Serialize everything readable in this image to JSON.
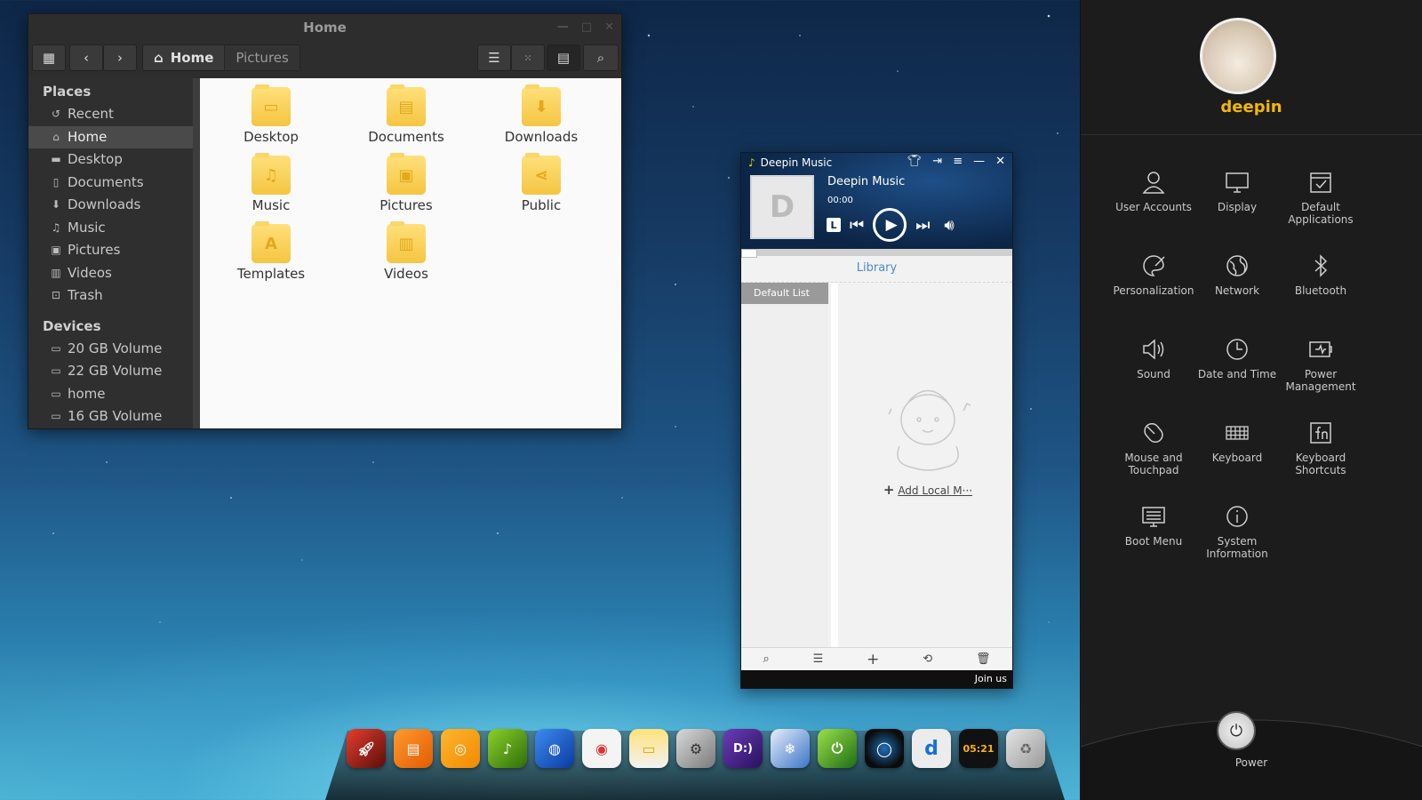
{
  "file_manager": {
    "title": "Home",
    "breadcrumb": [
      "Home",
      "Pictures"
    ],
    "sidebar": {
      "places_header": "Places",
      "places": [
        {
          "label": "Recent",
          "icon": "recent-icon"
        },
        {
          "label": "Home",
          "icon": "home-icon"
        },
        {
          "label": "Desktop",
          "icon": "desktop-icon"
        },
        {
          "label": "Documents",
          "icon": "documents-icon"
        },
        {
          "label": "Downloads",
          "icon": "downloads-icon"
        },
        {
          "label": "Music",
          "icon": "music-icon"
        },
        {
          "label": "Pictures",
          "icon": "pictures-icon"
        },
        {
          "label": "Videos",
          "icon": "videos-icon"
        },
        {
          "label": "Trash",
          "icon": "trash-icon"
        }
      ],
      "devices_header": "Devices",
      "devices": [
        "20 GB Volume",
        "22 GB Volume",
        "home",
        "16 GB Volume"
      ]
    },
    "folders": [
      "Desktop",
      "Documents",
      "Downloads",
      "Music",
      "Pictures",
      "Public",
      "Templates",
      "Videos"
    ]
  },
  "music_player": {
    "app_title": "Deepin Music",
    "song_title": "Deepin Music",
    "time": "00:00",
    "mode_label": "L",
    "library_tab": "Library",
    "playlist": "Default List",
    "add_link_plus": "+",
    "add_link": "Add Local M···",
    "join": "Join us"
  },
  "dock": {
    "items": [
      "launcher",
      "appstore",
      "deepin-movie",
      "deepin-music",
      "browser",
      "chrome",
      "file-manager",
      "system-settings",
      "deepin-terminal",
      "network",
      "power",
      "screen-recorder",
      "deepin-logo",
      "clock",
      "trash"
    ],
    "clock_label": "05:21"
  },
  "control_center": {
    "username": "deepin",
    "items": [
      {
        "label": "User Accounts",
        "icon": "user-icon"
      },
      {
        "label": "Display",
        "icon": "display-icon"
      },
      {
        "label": "Default Applications",
        "icon": "default-apps-icon"
      },
      {
        "label": "Personalization",
        "icon": "palette-icon"
      },
      {
        "label": "Network",
        "icon": "globe-icon"
      },
      {
        "label": "Bluetooth",
        "icon": "bluetooth-icon"
      },
      {
        "label": "Sound",
        "icon": "speaker-icon"
      },
      {
        "label": "Date and Time",
        "icon": "clock-icon"
      },
      {
        "label": "Power Management",
        "icon": "battery-icon"
      },
      {
        "label": "Mouse and Touchpad",
        "icon": "mouse-icon"
      },
      {
        "label": "Keyboard",
        "icon": "keyboard-icon"
      },
      {
        "label": "Keyboard Shortcuts",
        "icon": "fn-icon"
      },
      {
        "label": "Boot Menu",
        "icon": "boot-icon"
      },
      {
        "label": "System Information",
        "icon": "info-icon"
      }
    ],
    "power_label": "Power",
    "accent": "#f5b800"
  }
}
